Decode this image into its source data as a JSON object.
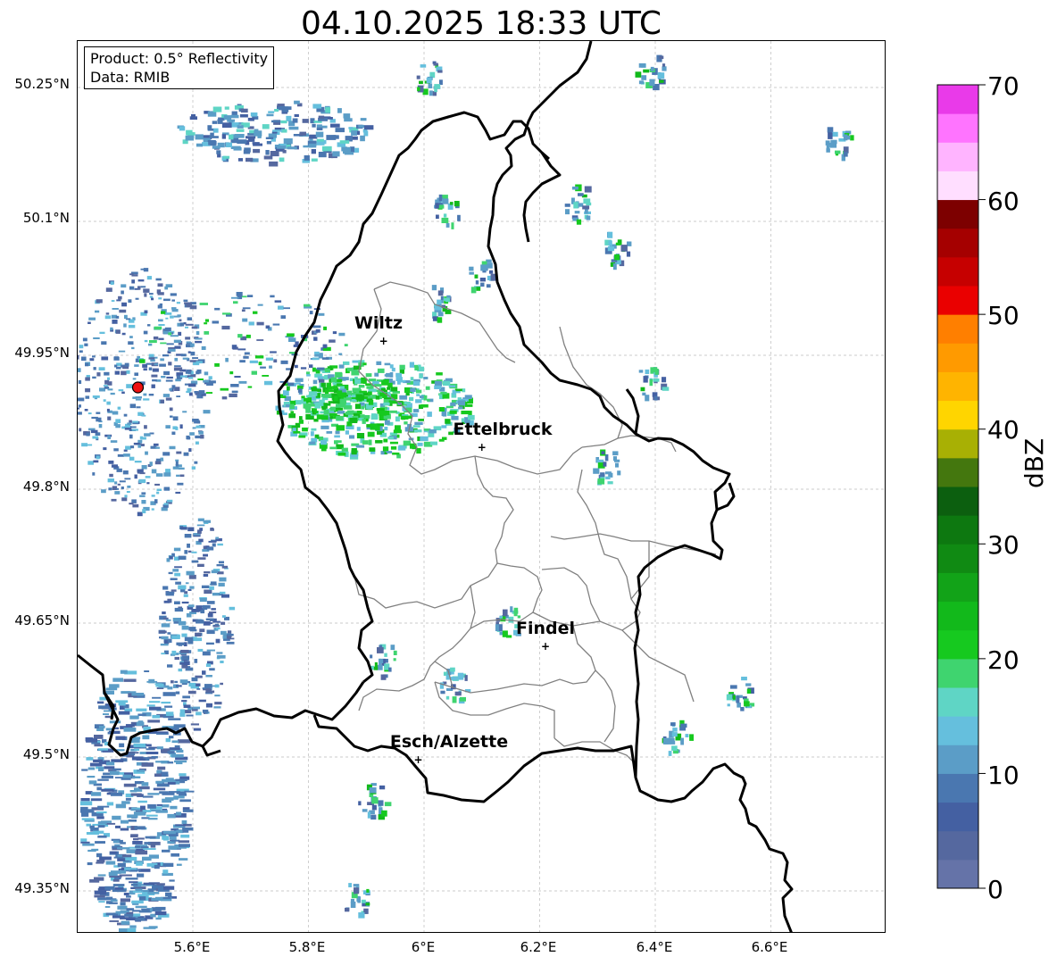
{
  "title": "04.10.2025 18:33 UTC",
  "info": {
    "product": "Product: 0.5° Reflectivity",
    "data": "Data: RMIB"
  },
  "axes": {
    "lat_labels": [
      "50.25°N",
      "50.1°N",
      "49.95°N",
      "49.8°N",
      "49.65°N",
      "49.5°N",
      "49.35°N"
    ],
    "lon_labels": [
      "5.6°E",
      "5.8°E",
      "6°E",
      "6.2°E",
      "6.4°E",
      "6.6°E"
    ],
    "lat_values": [
      50.25,
      50.1,
      49.95,
      49.8,
      49.65,
      49.5,
      49.35
    ],
    "lon_values": [
      5.6,
      5.8,
      6.0,
      6.2,
      6.4,
      6.6
    ],
    "grid": true
  },
  "cities": [
    {
      "name": "Wiltz",
      "lon": 5.93,
      "lat": 49.966
    },
    {
      "name": "Ettelbruck",
      "lon": 6.1,
      "lat": 49.847
    },
    {
      "name": "Findel",
      "lon": 6.21,
      "lat": 49.624
    },
    {
      "name": "Esch/Alzette",
      "lon": 5.99,
      "lat": 49.497
    }
  ],
  "radar_site": {
    "lon": 5.505,
    "lat": 49.914,
    "color": "#ee1111"
  },
  "colorbar": {
    "label": "dBZ",
    "ticks": [
      "0",
      "10",
      "20",
      "30",
      "40",
      "50",
      "60",
      "70"
    ],
    "min": 0,
    "max": 70,
    "colors": [
      "#6573a8",
      "#55689f",
      "#4460a2",
      "#4a77b0",
      "#5b9dc7",
      "#65bfdd",
      "#5fd5c5",
      "#3fd46f",
      "#16c91f",
      "#12b91b",
      "#12a318",
      "#108a13",
      "#0d7810",
      "#0c5f0f",
      "#44770e",
      "#a8b004",
      "#ffd500",
      "#ffb400",
      "#ff9a00",
      "#ff7f00",
      "#ea0000",
      "#c60000",
      "#a50000",
      "#7d0000",
      "#ffdeff",
      "#ffb4ff",
      "#ff74ff",
      "#e93ae9"
    ]
  }
}
